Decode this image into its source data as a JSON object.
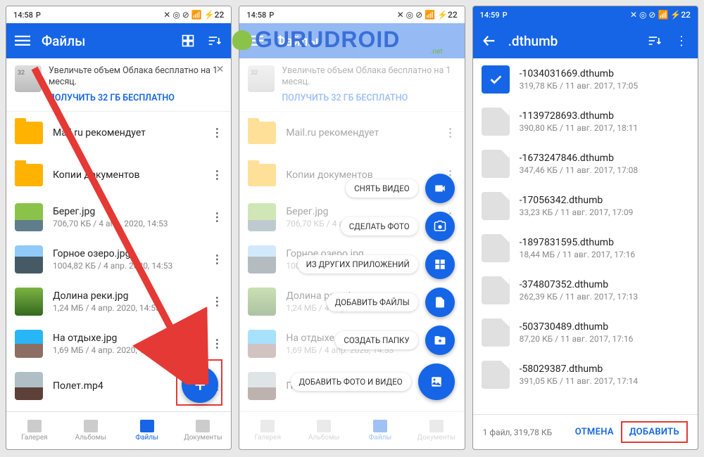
{
  "status_time": "14:58",
  "status_time3": "14:59",
  "watermark": "GURUDROID",
  "watermark_net": ".net",
  "screen1": {
    "title": "Файлы",
    "promo_text": "Увеличьте объем Облака бесплатно на 1 месяц.",
    "promo_link": "ПОЛУЧИТЬ 32 ГБ БЕСПЛАТНО",
    "rows": [
      {
        "name": "Mail.ru рекомендует",
        "meta": "",
        "thumb": "folder"
      },
      {
        "name": "Копии документов",
        "meta": "",
        "thumb": "folder"
      },
      {
        "name": "Берег.jpg",
        "meta": "706,70 КБ / 4 апр. 2020, 14:53",
        "thumb": "img1"
      },
      {
        "name": "Горное озеро.jpg",
        "meta": "1004,82 КБ / 4 апр. 2020, 14:53",
        "thumb": "img2"
      },
      {
        "name": "Долина реки.jpg",
        "meta": "1,24 МБ / 4 апр. 2020, 14:53",
        "thumb": "img3"
      },
      {
        "name": "На отдыхе.jpg",
        "meta": "1,69 МБ / 4 апр. 2020, 14:53",
        "thumb": "img4"
      },
      {
        "name": "Полет.mp4",
        "meta": "",
        "thumb": "img5"
      }
    ],
    "nav": [
      "Галерея",
      "Альбомы",
      "Файлы",
      "Документы"
    ]
  },
  "screen2": {
    "menu": [
      "СНЯТЬ ВИДЕО",
      "СДЕЛАТЬ ФОТО",
      "ИЗ ДРУГИХ ПРИЛОЖЕНИЙ",
      "ДОБАВИТЬ ФАЙЛЫ",
      "СОЗДАТЬ ПАПКУ",
      "ДОБАВИТЬ ФОТО И ВИДЕО"
    ]
  },
  "screen3": {
    "title": ".dthumb",
    "rows": [
      {
        "name": "-1034031669.dthumb",
        "meta": "319,78 КБ / 11 авг. 2017, 17:05",
        "sel": true
      },
      {
        "name": "-1139728693.dthumb",
        "meta": "390,80 КБ / 11 авг. 2017, 18:11"
      },
      {
        "name": "-1673247846.dthumb",
        "meta": "347,46 КБ / 11 авг. 2017, 17:08"
      },
      {
        "name": "-17056342.dthumb",
        "meta": "33,23 КБ / 11 авг. 2017, 17:09"
      },
      {
        "name": "-1897831595.dthumb",
        "meta": "18,44 МБ / 11 авг. 2017, 17:16"
      },
      {
        "name": "-374807352.dthumb",
        "meta": "262,39 КБ / 11 авг. 2017, 17:13"
      },
      {
        "name": "-503730489.dthumb",
        "meta": "87,20 КБ / 11 авг. 2017, 17:16"
      },
      {
        "name": "-58029387.dthumb",
        "meta": "391,05 КБ / 11 авг. 2017, 17:14"
      }
    ],
    "summary": "1 файл, 319,78 КБ",
    "cancel": "ОТМЕНА",
    "add": "ДОБАВИТЬ"
  }
}
